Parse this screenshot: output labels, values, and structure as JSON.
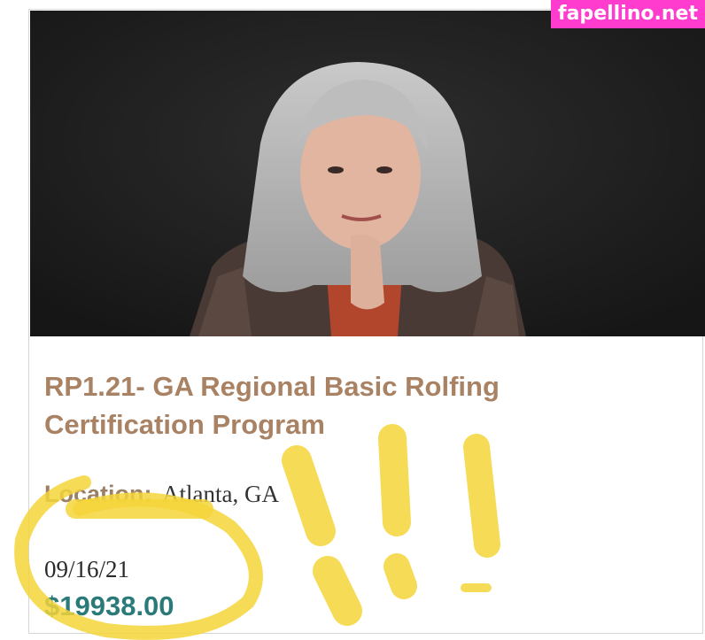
{
  "listing": {
    "title": "RP1.21- GA Regional Basic Rolfing Certification Program",
    "location_label": "Location:",
    "location_value": "Atlanta, GA",
    "date": "09/16/21",
    "price": "$19938.00",
    "photo_alt": "Portrait photo"
  },
  "watermark": {
    "text": "fapellino.net"
  },
  "colors": {
    "title": "#a98264",
    "price": "#2a7a7a",
    "watermark_bg": "#ff3ccd",
    "annotation": "#f5d53a"
  }
}
